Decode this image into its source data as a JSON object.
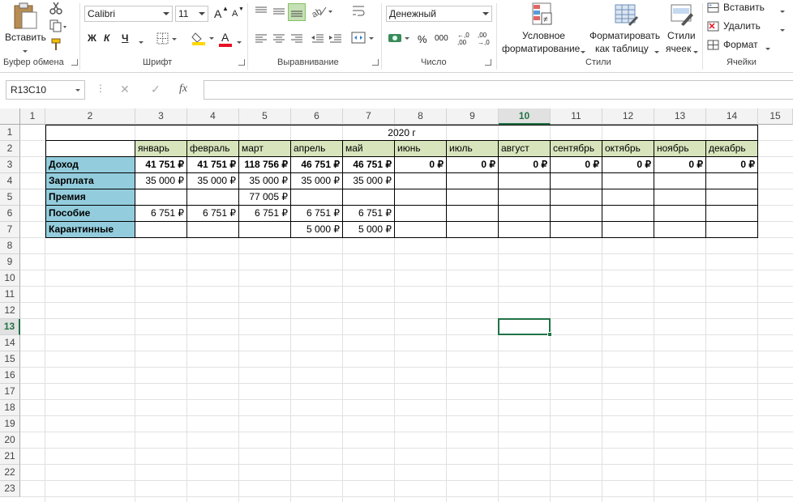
{
  "ribbon": {
    "clipboard": {
      "paste_label": "Вставить",
      "group_label": "Буфер обмена"
    },
    "font": {
      "font_name": "Calibri",
      "font_size": "11",
      "grow_label": "A",
      "shrink_label": "A",
      "bold_label": "Ж",
      "italic_label": "К",
      "underline_label": "Ч",
      "fill_label": "A",
      "color_label": "A",
      "group_label": "Шрифт"
    },
    "alignment": {
      "group_label": "Выравнивание"
    },
    "number": {
      "format": "Денежный",
      "percent_label": "%",
      "thousands_label": "000",
      "inc_decimal_label": "←,0 ,00",
      "dec_decimal_label": ",00 →,0",
      "group_label": "Число"
    },
    "styles": {
      "cond_format_line1": "Условное",
      "cond_format_line2": "форматирование",
      "format_table_line1": "Форматировать",
      "format_table_line2": "как таблицу",
      "cell_styles_line1": "Стили",
      "cell_styles_line2": "ячеек",
      "group_label": "Стили"
    },
    "cells": {
      "insert_label": "Вставить",
      "delete_label": "Удалить",
      "format_label": "Формат",
      "group_label": "Ячейки"
    },
    "colors": {
      "accent": "#217346",
      "font_color": "#e81123",
      "fill_color": "#ffd700"
    }
  },
  "formula_bar": {
    "name_box": "R13C10",
    "cancel_icon": "✕",
    "enter_icon": "✓",
    "fx_label": "fx",
    "content": ""
  },
  "columns": [
    "1",
    "2",
    "3",
    "4",
    "5",
    "6",
    "7",
    "8",
    "9",
    "10",
    "11",
    "12",
    "13",
    "14",
    "15"
  ],
  "rows": [
    "1",
    "2",
    "3",
    "4",
    "5",
    "6",
    "7",
    "8",
    "9",
    "10",
    "11",
    "12",
    "13",
    "14",
    "15",
    "16",
    "17",
    "18",
    "19",
    "20",
    "21",
    "22",
    "23"
  ],
  "selected": {
    "row": "13",
    "col": "10"
  },
  "sheet": {
    "title": "2020 г",
    "months": [
      "январь",
      "февраль",
      "март",
      "апрель",
      "май",
      "июнь",
      "июль",
      "август",
      "сентябрь",
      "октябрь",
      "ноябрь",
      "декабрь"
    ],
    "row_labels": [
      "Доход",
      "Зарплата",
      "Премия",
      "Пособие",
      "Карантинные"
    ],
    "income": [
      "41 751 ₽",
      "41 751 ₽",
      "118 756 ₽",
      "46 751 ₽",
      "46 751 ₽",
      "0 ₽",
      "0 ₽",
      "0 ₽",
      "0 ₽",
      "0 ₽",
      "0 ₽",
      "0 ₽"
    ],
    "salary": [
      "35 000 ₽",
      "35 000 ₽",
      "35 000 ₽",
      "35 000 ₽",
      "35 000 ₽",
      "",
      "",
      "",
      "",
      "",
      "",
      ""
    ],
    "bonus": [
      "",
      "",
      "77 005 ₽",
      "",
      "",
      "",
      "",
      "",
      "",
      "",
      "",
      ""
    ],
    "allowance": [
      "6 751 ₽",
      "6 751 ₽",
      "6 751 ₽",
      "6 751 ₽",
      "6 751 ₽",
      "",
      "",
      "",
      "",
      "",
      "",
      ""
    ],
    "quarantine": [
      "",
      "",
      "",
      "5 000 ₽",
      "5 000 ₽",
      "",
      "",
      "",
      "",
      "",
      "",
      ""
    ],
    "colors": {
      "header_fill": "#d8e4bc",
      "label_fill": "#93cddd"
    }
  }
}
